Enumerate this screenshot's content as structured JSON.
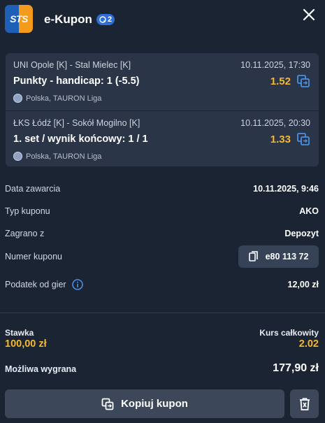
{
  "header": {
    "logo_text": "STS",
    "title": "e-Kupon",
    "count": "2",
    "colors": {
      "logo_orange": "#f49b1c",
      "logo_blue": "#1e5fb8",
      "badge": "#2e6fd6"
    }
  },
  "bets": [
    {
      "teams": "UNI Opole [K] - Stal Mielec [K]",
      "date": "10.11.2025, 17:30",
      "market": "Punkty - handicap: 1 (-5.5)",
      "odds": "1.52",
      "league": "Polska, TAURON Liga"
    },
    {
      "teams": "ŁKS Łódź [K] - Sokół Mogilno [K]",
      "date": "10.11.2025, 20:30",
      "market": "1. set / wynik końcowy: 1 / 1",
      "odds": "1.33",
      "league": "Polska, TAURON Liga"
    }
  ],
  "details": {
    "date_label": "Data zawarcia",
    "date_value": "10.11.2025, 9:46",
    "type_label": "Typ kuponu",
    "type_value": "AKO",
    "source_label": "Zagrano z",
    "source_value": "Depozyt",
    "number_label": "Numer kuponu",
    "number_value": "e80 113 72",
    "tax_label": "Podatek od gier",
    "tax_value": "12,00 zł"
  },
  "summary": {
    "stake_label": "Stawka",
    "stake_value": "100,00 zł",
    "rate_label": "Kurs całkowity",
    "rate_value": "2.02",
    "win_label": "Możliwa wygrana",
    "win_value": "177,90 zł"
  },
  "actions": {
    "copy_label": "Kopiuj kupon"
  },
  "accent_colors": {
    "odds": "#f5b82e",
    "background": "#1b2433",
    "card": "#2a3547"
  }
}
